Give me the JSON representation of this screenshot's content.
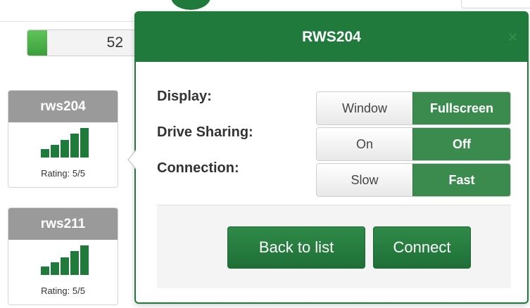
{
  "progress": {
    "count": "52",
    "fill_fraction": 0.15
  },
  "machines": [
    {
      "name": "rws204",
      "rating": "Rating: 5/5",
      "signal_bars": 5
    },
    {
      "name": "rws211",
      "rating": "Rating: 5/5",
      "signal_bars": 5
    }
  ],
  "popover": {
    "title": "RWS204",
    "close_icon": "close-icon",
    "options": [
      {
        "label": "Display:",
        "choices": [
          "Window",
          "Fullscreen"
        ],
        "selected": "Fullscreen"
      },
      {
        "label": "Drive Sharing:",
        "choices": [
          "On",
          "Off"
        ],
        "selected": "Off"
      },
      {
        "label": "Connection:",
        "choices": [
          "Slow",
          "Fast"
        ],
        "selected": "Fast"
      }
    ],
    "back_label": "Back to list",
    "connect_label": "Connect"
  },
  "colors": {
    "accent": "#1f7a3c",
    "selected": "#3b8a4e",
    "card_header": "#9a9a9a",
    "progress": "#4cb34a"
  }
}
